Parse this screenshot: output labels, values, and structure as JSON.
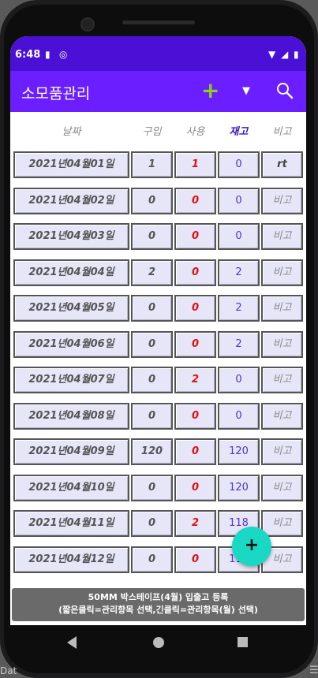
{
  "status_bar": {
    "time": "6:48"
  },
  "app_bar": {
    "title": "소모품관리",
    "add_icon": "+",
    "dropdown_icon": "▼"
  },
  "table": {
    "headers": {
      "date": "날짜",
      "buy": "구입",
      "use": "사용",
      "stock": "재고",
      "note": "비고"
    },
    "rows": [
      {
        "date": "2021년04월01일",
        "buy": "1",
        "use": "1",
        "stock": "0",
        "note": "rt"
      },
      {
        "date": "2021년04월02일",
        "buy": "0",
        "use": "0",
        "stock": "0",
        "note": "비고"
      },
      {
        "date": "2021년04월03일",
        "buy": "0",
        "use": "0",
        "stock": "0",
        "note": "비고"
      },
      {
        "date": "2021년04월04일",
        "buy": "2",
        "use": "0",
        "stock": "2",
        "note": "비고"
      },
      {
        "date": "2021년04월05일",
        "buy": "0",
        "use": "0",
        "stock": "2",
        "note": "비고"
      },
      {
        "date": "2021년04월06일",
        "buy": "0",
        "use": "0",
        "stock": "2",
        "note": "비고"
      },
      {
        "date": "2021년04월07일",
        "buy": "0",
        "use": "2",
        "stock": "0",
        "note": "비고"
      },
      {
        "date": "2021년04월08일",
        "buy": "0",
        "use": "0",
        "stock": "0",
        "note": "비고"
      },
      {
        "date": "2021년04월09일",
        "buy": "120",
        "use": "0",
        "stock": "120",
        "note": "비고"
      },
      {
        "date": "2021년04월10일",
        "buy": "0",
        "use": "0",
        "stock": "120",
        "note": "비고"
      },
      {
        "date": "2021년04월11일",
        "buy": "0",
        "use": "2",
        "stock": "118",
        "note": "비고"
      },
      {
        "date": "2021년04월12일",
        "buy": "0",
        "use": "0",
        "stock": "118",
        "note": "비고"
      }
    ]
  },
  "toast": {
    "line1": "50MM 박스테이프(4월)  입출고 등록",
    "line2": "(짧은클릭=관리항목 선택,긴클릭=관리항목(월) 선택)"
  },
  "fab": {
    "icon": "+"
  },
  "edge": {
    "label": "Dat",
    "menu": "☰"
  },
  "colors": {
    "status_bar": "#4b10d6",
    "app_bar": "#6b1eff",
    "fab": "#19d8c4",
    "use_value": "#e01010",
    "stock_value": "#5533cc"
  }
}
